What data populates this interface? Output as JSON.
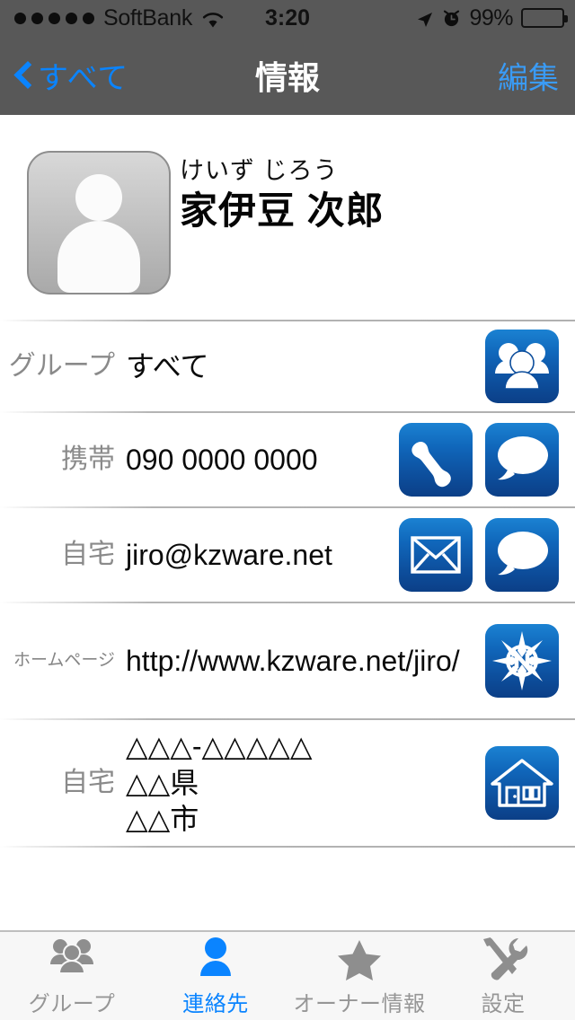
{
  "status_bar": {
    "signal_dots": 5,
    "carrier": "SoftBank",
    "wifi_icon": "wifi-icon",
    "time": "3:20",
    "location_icon": "location-arrow-icon",
    "alarm_icon": "alarm-clock-icon",
    "battery_percent": "99%",
    "battery_icon": "battery-full-icon",
    "background_color": "#585858"
  },
  "nav_bar": {
    "back_icon": "chevron-left-icon",
    "back_label": "すべて",
    "title": "情報",
    "edit_label": "編集",
    "tint_color": "#0a84ff",
    "background_color": "#585858"
  },
  "contact": {
    "avatar_icon": "person-placeholder-icon",
    "name_kana": "けいず じろう",
    "name": "家伊豆 次郎"
  },
  "fields": [
    {
      "label": "グループ",
      "label_size": "normal",
      "value": "すべて",
      "actions": [
        "group-icon"
      ]
    },
    {
      "label": "携帯",
      "label_size": "normal",
      "value": "090 0000 0000",
      "actions": [
        "phone-icon",
        "message-icon"
      ]
    },
    {
      "label": "自宅",
      "label_size": "normal",
      "value": "jiro@kzware.net",
      "actions": [
        "mail-icon",
        "message-icon"
      ]
    },
    {
      "label": "ホームページ",
      "label_size": "small",
      "value": "http://www.kzware.net/jiro/",
      "actions": [
        "compass-icon"
      ]
    },
    {
      "label": "自宅",
      "label_size": "normal",
      "value": "△△△-△△△△△\n△△県\n△△市",
      "actions": [
        "house-icon"
      ]
    }
  ],
  "tab_bar": {
    "items": [
      {
        "icon": "group-people-icon",
        "label": "グループ",
        "active": false
      },
      {
        "icon": "person-icon",
        "label": "連絡先",
        "active": true
      },
      {
        "icon": "star-icon",
        "label": "オーナー情報",
        "active": false
      },
      {
        "icon": "tools-icon",
        "label": "設定",
        "active": false
      }
    ],
    "active_color": "#0a84ff",
    "inactive_color": "#969696"
  }
}
